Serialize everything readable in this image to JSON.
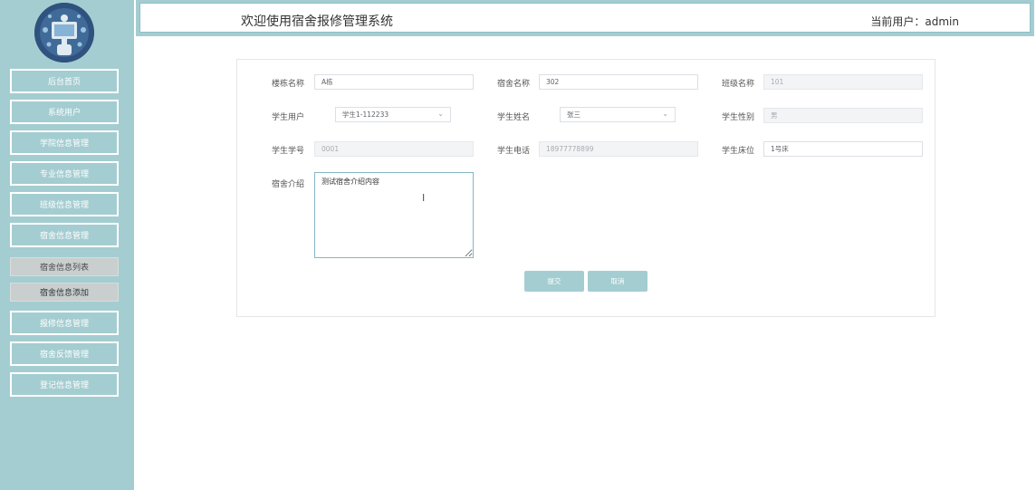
{
  "header": {
    "title": "欢迎使用宿舍报修管理系统",
    "user_label": "当前用户：admin"
  },
  "sidebar": {
    "items": [
      {
        "label": "后台首页"
      },
      {
        "label": "系统用户"
      },
      {
        "label": "学院信息管理"
      },
      {
        "label": "专业信息管理"
      },
      {
        "label": "班级信息管理"
      },
      {
        "label": "宿舍信息管理"
      },
      {
        "label": "宿舍信息列表"
      },
      {
        "label": "宿舍信息添加"
      },
      {
        "label": "报修信息管理"
      },
      {
        "label": "宿舍反馈管理"
      },
      {
        "label": "登记信息管理"
      }
    ]
  },
  "form": {
    "building_label": "楼栋名称",
    "building_value": "A栋",
    "dorm_label": "宿舍名称",
    "dorm_value": "302",
    "class_label": "班级名称",
    "class_value": "101",
    "student_user_label": "学生用户",
    "student_user_value": "学生1-112233",
    "student_name_label": "学生姓名",
    "student_name_value": "张三",
    "gender_label": "学生性别",
    "gender_value": "男",
    "student_no_label": "学生学号",
    "student_no_value": "0001",
    "phone_label": "学生电话",
    "phone_value": "18977778899",
    "bed_label": "学生床位",
    "bed_value": "1号床",
    "intro_label": "宿舍介绍",
    "intro_value": "测试宿舍介绍内容",
    "submit_label": "提交",
    "cancel_label": "取消"
  },
  "colors": {
    "accent": "#a4cdd1",
    "sub_item_bg": "#c9cfcf"
  }
}
